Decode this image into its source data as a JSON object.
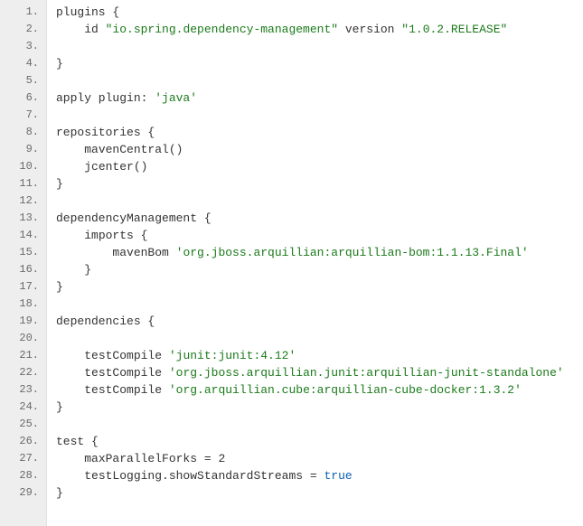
{
  "gutter_suffix": ".",
  "lines": [
    {
      "n": 1,
      "segs": [
        {
          "t": "plugins {"
        }
      ]
    },
    {
      "n": 2,
      "segs": [
        {
          "t": "    id "
        },
        {
          "t": "\"io.spring.dependency-management\"",
          "cls": "tok-str"
        },
        {
          "t": " version "
        },
        {
          "t": "\"1.0.2.RELEASE\"",
          "cls": "tok-str"
        }
      ]
    },
    {
      "n": 3,
      "segs": []
    },
    {
      "n": 4,
      "segs": [
        {
          "t": "}"
        }
      ]
    },
    {
      "n": 5,
      "segs": []
    },
    {
      "n": 6,
      "segs": [
        {
          "t": "apply plugin: "
        },
        {
          "t": "'java'",
          "cls": "tok-str"
        }
      ]
    },
    {
      "n": 7,
      "segs": []
    },
    {
      "n": 8,
      "segs": [
        {
          "t": "repositories {"
        }
      ]
    },
    {
      "n": 9,
      "segs": [
        {
          "t": "    mavenCentral()"
        }
      ]
    },
    {
      "n": 10,
      "segs": [
        {
          "t": "    jcenter()"
        }
      ]
    },
    {
      "n": 11,
      "segs": [
        {
          "t": "}"
        }
      ]
    },
    {
      "n": 12,
      "segs": []
    },
    {
      "n": 13,
      "segs": [
        {
          "t": "dependencyManagement {"
        }
      ]
    },
    {
      "n": 14,
      "segs": [
        {
          "t": "    imports {"
        }
      ]
    },
    {
      "n": 15,
      "segs": [
        {
          "t": "        mavenBom "
        },
        {
          "t": "'org.jboss.arquillian:arquillian-bom:1.1.13.Final'",
          "cls": "tok-str"
        }
      ]
    },
    {
      "n": 16,
      "segs": [
        {
          "t": "    }"
        }
      ]
    },
    {
      "n": 17,
      "segs": [
        {
          "t": "}"
        }
      ]
    },
    {
      "n": 18,
      "segs": []
    },
    {
      "n": 19,
      "segs": [
        {
          "t": "dependencies {"
        }
      ]
    },
    {
      "n": 20,
      "segs": []
    },
    {
      "n": 21,
      "segs": [
        {
          "t": "    testCompile "
        },
        {
          "t": "'junit:junit:4.12'",
          "cls": "tok-str"
        }
      ]
    },
    {
      "n": 22,
      "segs": [
        {
          "t": "    testCompile "
        },
        {
          "t": "'org.jboss.arquillian.junit:arquillian-junit-standalone'",
          "cls": "tok-str"
        }
      ]
    },
    {
      "n": 23,
      "segs": [
        {
          "t": "    testCompile "
        },
        {
          "t": "'org.arquillian.cube:arquillian-cube-docker:1.3.2'",
          "cls": "tok-str"
        }
      ]
    },
    {
      "n": 24,
      "segs": [
        {
          "t": "}"
        }
      ]
    },
    {
      "n": 25,
      "segs": []
    },
    {
      "n": 26,
      "segs": [
        {
          "t": "test {"
        }
      ]
    },
    {
      "n": 27,
      "segs": [
        {
          "t": "    maxParallelForks = 2"
        }
      ]
    },
    {
      "n": 28,
      "segs": [
        {
          "t": "    testLogging.showStandardStreams = "
        },
        {
          "t": "true",
          "cls": "tok-kw"
        }
      ]
    },
    {
      "n": 29,
      "segs": [
        {
          "t": "}"
        }
      ]
    }
  ]
}
